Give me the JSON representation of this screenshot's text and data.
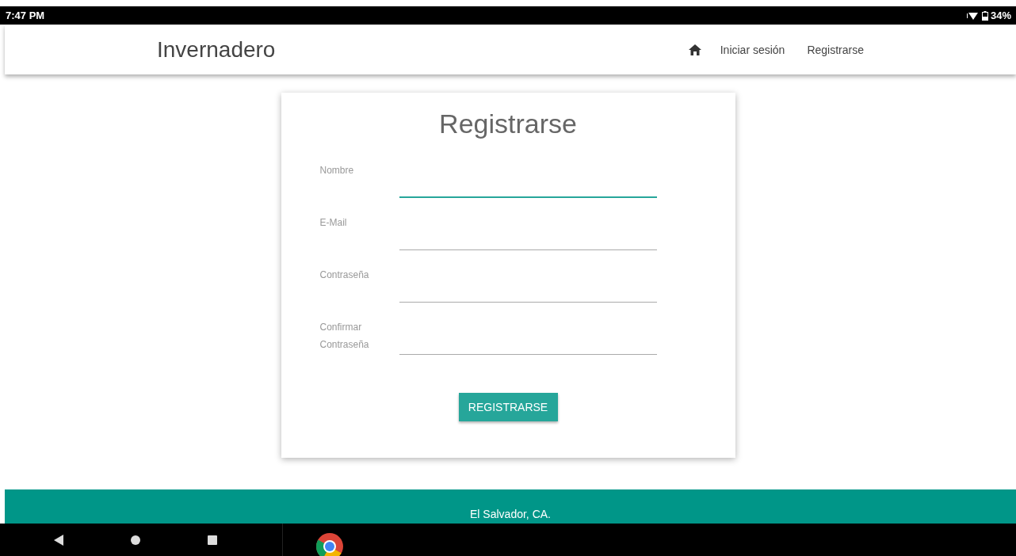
{
  "status_bar": {
    "time": "7:47 PM",
    "battery": "34%"
  },
  "header": {
    "brand": "Invernadero",
    "nav": [
      {
        "kind": "home"
      },
      {
        "kind": "link",
        "label": "Iniciar sesión"
      },
      {
        "kind": "link",
        "label": "Registrarse"
      }
    ]
  },
  "form": {
    "title": "Registrarse",
    "fields": [
      {
        "label": "Nombre",
        "focused": true
      },
      {
        "label": "E-Mail",
        "focused": false
      },
      {
        "label": "Contraseña",
        "focused": false
      },
      {
        "label": "Confirmar Contraseña",
        "focused": false
      }
    ],
    "submit": "REGISTRARSE"
  },
  "footer": {
    "text": "El Salvador, CA."
  }
}
